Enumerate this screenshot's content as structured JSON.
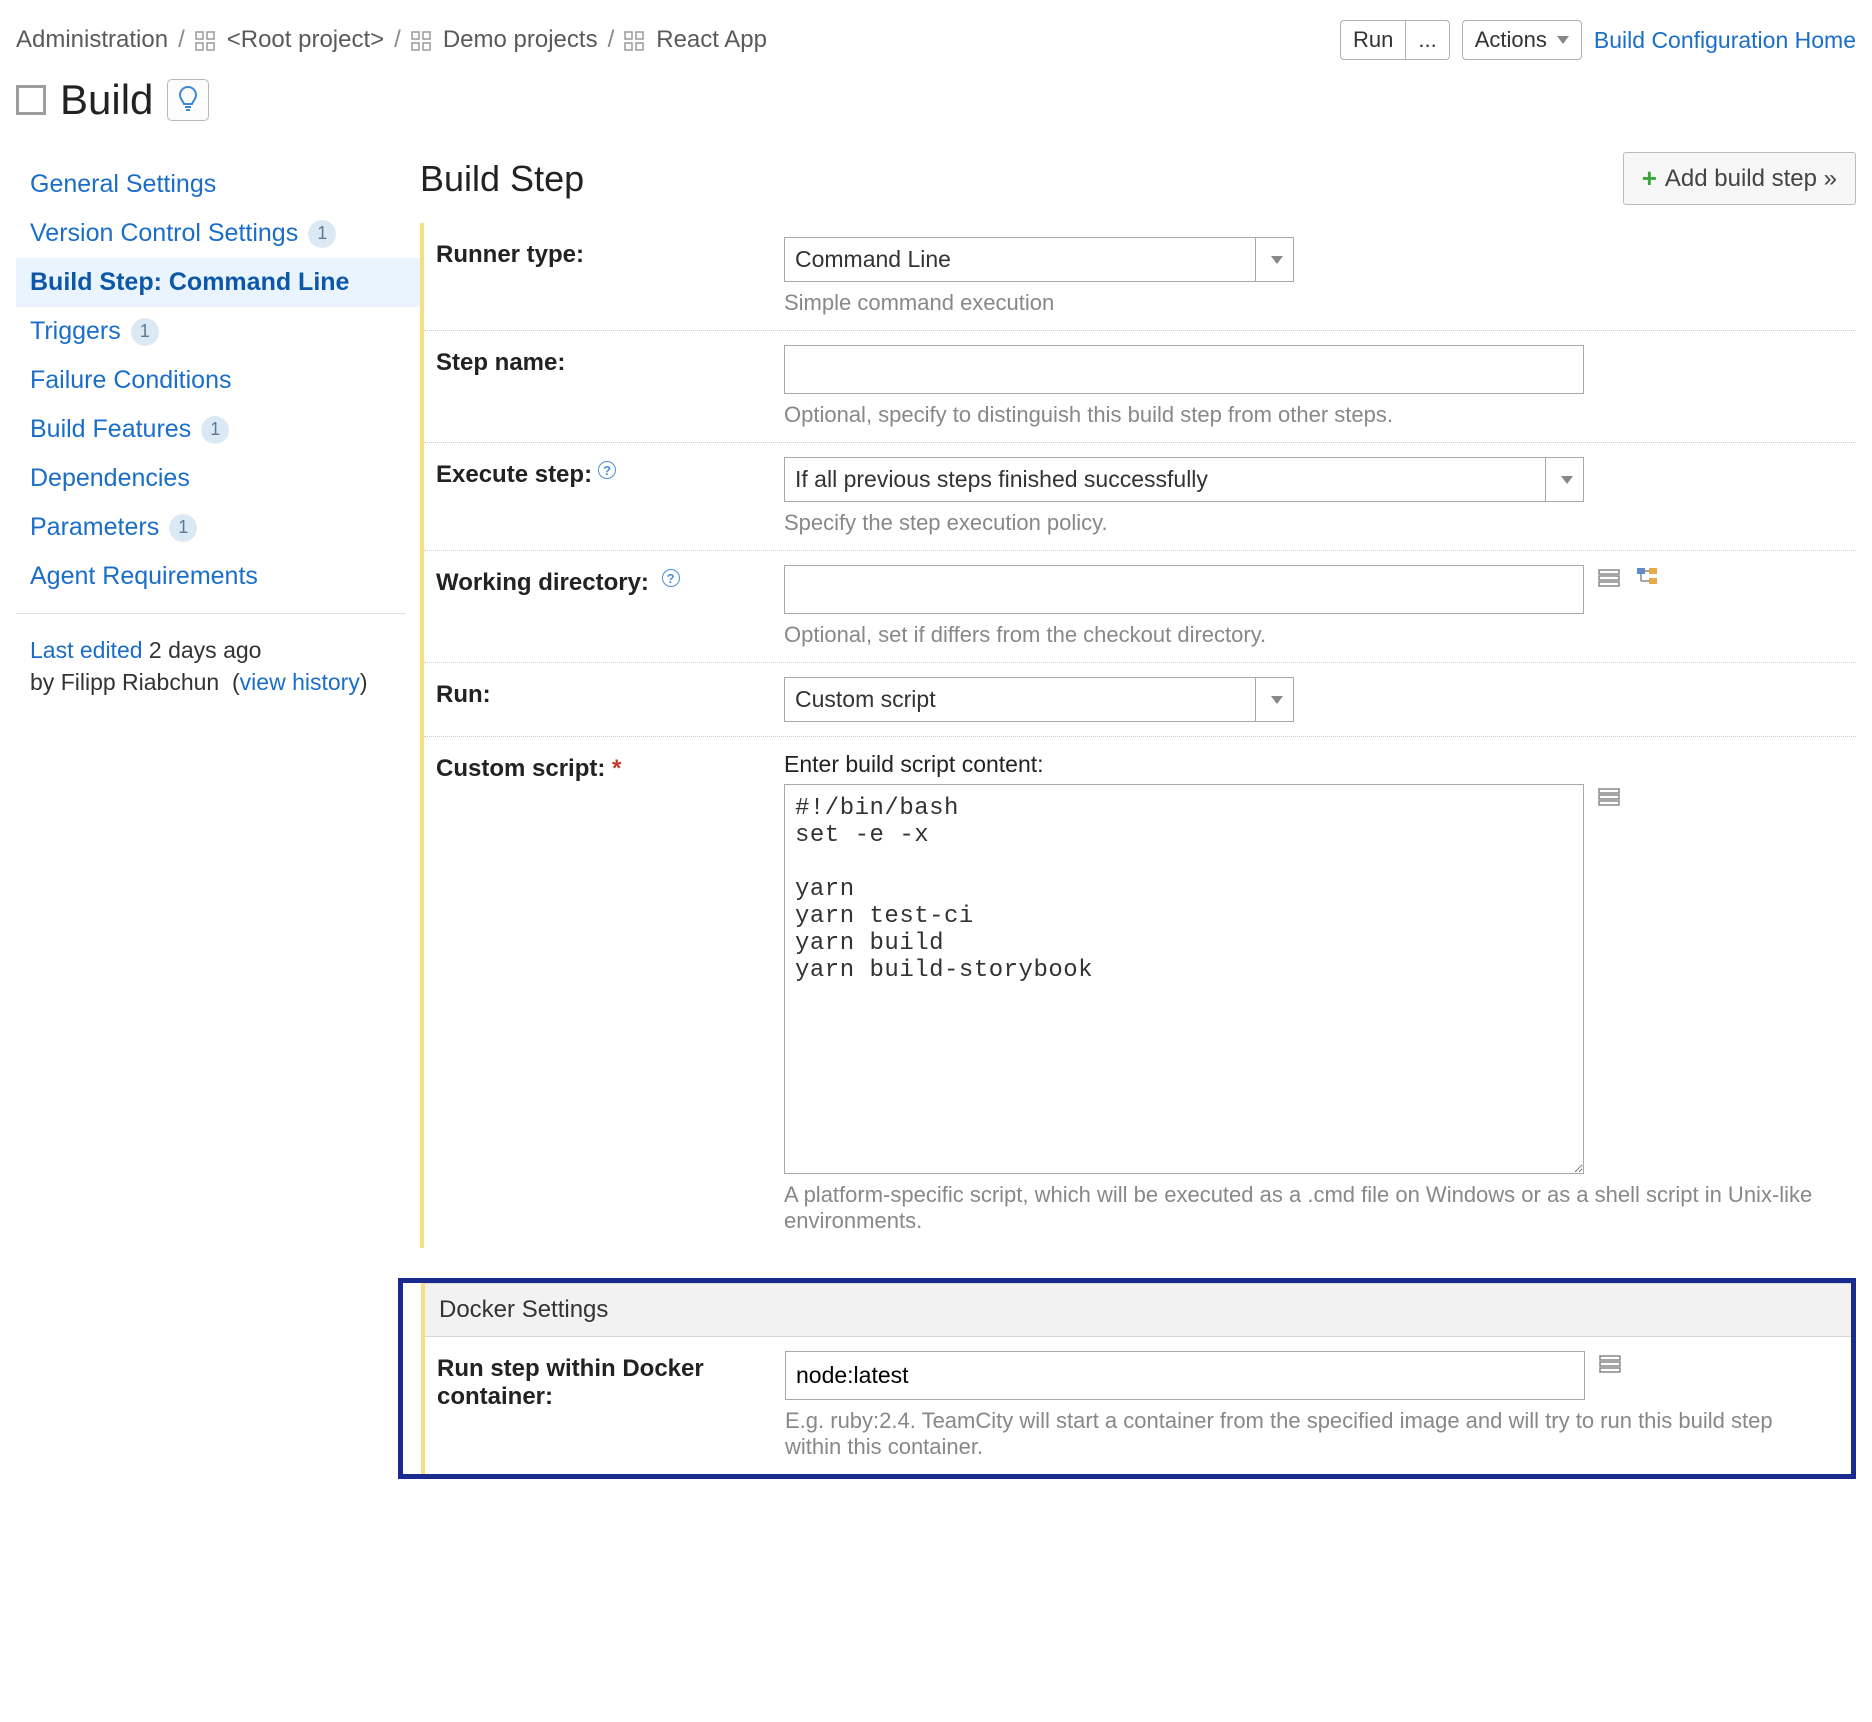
{
  "breadcrumb": {
    "root": "Administration",
    "items": [
      "<Root project>",
      "Demo projects",
      "React App"
    ]
  },
  "topbar": {
    "run": "Run",
    "dots": "...",
    "actions": "Actions",
    "home_link": "Build Configuration Home"
  },
  "title": "Build",
  "sidebar": {
    "items": [
      {
        "label": "General Settings"
      },
      {
        "label": "Version Control Settings",
        "badge": "1"
      },
      {
        "label": "Build Step: Command Line",
        "active": true
      },
      {
        "label": "Triggers",
        "badge": "1"
      },
      {
        "label": "Failure Conditions"
      },
      {
        "label": "Build Features",
        "badge": "1"
      },
      {
        "label": "Dependencies"
      },
      {
        "label": "Parameters",
        "badge": "1"
      },
      {
        "label": "Agent Requirements"
      }
    ]
  },
  "meta": {
    "last_edited_prefix": "Last edited",
    "last_edited_time": "2 days ago",
    "by_prefix": "by",
    "author": "Filipp Riabchun",
    "history": "view history"
  },
  "main": {
    "heading": "Build Step",
    "add_btn": "Add build step »"
  },
  "form": {
    "runner_type": {
      "label": "Runner type:",
      "value": "Command Line",
      "help": "Simple command execution"
    },
    "step_name": {
      "label": "Step name:",
      "value": "",
      "help": "Optional, specify to distinguish this build step from other steps."
    },
    "execute_step": {
      "label": "Execute step:",
      "value": "If all previous steps finished successfully",
      "help": "Specify the step execution policy."
    },
    "working_dir": {
      "label": "Working directory:",
      "value": "",
      "help": "Optional, set if differs from the checkout directory."
    },
    "run": {
      "label": "Run:",
      "value": "Custom script"
    },
    "custom_script": {
      "label": "Custom script:",
      "above": "Enter build script content:",
      "content": "#!/bin/bash\nset -e -x\n\nyarn\nyarn test-ci\nyarn build\nyarn build-storybook",
      "help": "A platform-specific script, which will be executed as a .cmd file on Windows or as a shell script in Unix-like environments."
    }
  },
  "docker": {
    "header": "Docker Settings",
    "label": "Run step within Docker container:",
    "value": "node:latest",
    "help": "E.g. ruby:2.4. TeamCity will start a container from the specified image and will try to run this build step within this container."
  }
}
